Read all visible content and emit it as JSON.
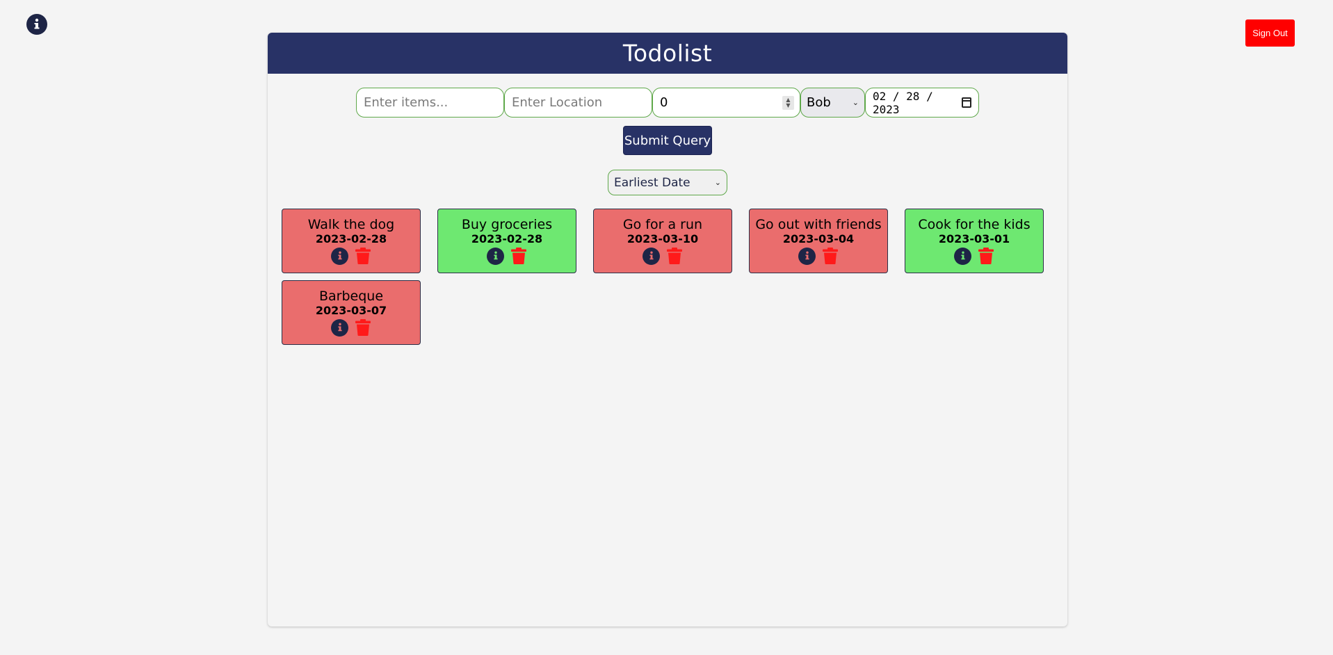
{
  "header": {
    "title": "Todolist"
  },
  "top_bar": {
    "sign_out_label": "Sign Out"
  },
  "form": {
    "items_placeholder": "Enter items...",
    "location_placeholder": "Enter Location",
    "number_value": "0",
    "owner_selected": "Bob",
    "date_value": "02 / 28 / 2023",
    "submit_label": "Submit Query"
  },
  "sort": {
    "selected": "Earliest Date"
  },
  "todos": [
    {
      "title": "Walk the dog",
      "date": "2023-02-28",
      "status": "overdue"
    },
    {
      "title": "Buy groceries",
      "date": "2023-02-28",
      "status": "upcoming"
    },
    {
      "title": "Go for a run",
      "date": "2023-03-10",
      "status": "overdue"
    },
    {
      "title": "Go out with friends",
      "date": "2023-03-04",
      "status": "overdue"
    },
    {
      "title": "Cook for the kids",
      "date": "2023-03-01",
      "status": "upcoming"
    },
    {
      "title": "Barbeque",
      "date": "2023-03-07",
      "status": "overdue"
    }
  ],
  "colors": {
    "header_bg": "#283266",
    "overdue_card": "#ea6d6d",
    "upcoming_card": "#6ee871",
    "sign_out_bg": "#ff0000",
    "trash_icon": "#ff1a1a",
    "info_icon_bg": "#1e2546"
  },
  "icons": {
    "corner": "info-icon",
    "card_info": "info-icon",
    "card_delete": "trash-icon",
    "date_picker": "calendar-icon"
  }
}
